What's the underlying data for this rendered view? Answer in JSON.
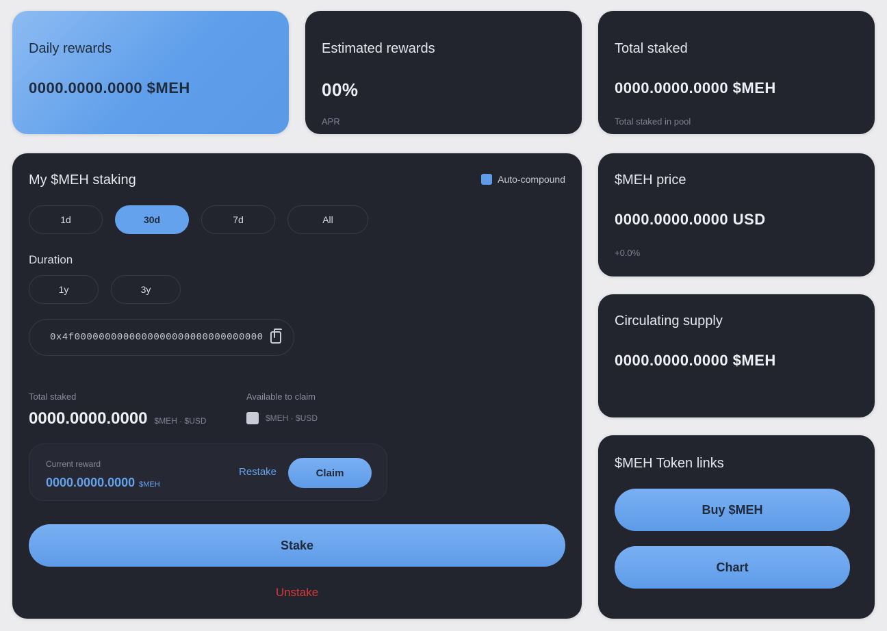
{
  "daily_rewards": {
    "title": "Daily rewards",
    "value": "0000.0000.0000 $MEH"
  },
  "estimated_rewards": {
    "title": "Estimated rewards",
    "value": "00%",
    "sub": "APR"
  },
  "total_staked": {
    "title": "Total staked",
    "value": "0000.0000.0000 $MEH",
    "sub": "Total staked in pool"
  },
  "staking": {
    "title": "My $MEH staking",
    "auto_compound_label": "Auto-compound",
    "periods": [
      "1d",
      "30d",
      "7d",
      "All"
    ],
    "active_period": "30d",
    "duration_label": "Duration",
    "durations": [
      "1y",
      "3y"
    ],
    "address_value": "0x4f0000000000000000000000000000000",
    "total_staked_label": "Total staked",
    "total_staked_value": "0000.0000.0000",
    "total_staked_unit": "$MEH · $USD",
    "available_label": "Available to claim",
    "available_value": "$MEH · $USD",
    "claim_label": "Current reward",
    "claim_value": "0000.0000.0000",
    "claim_unit": "$MEH",
    "restake_label": "Restake",
    "claim_button": "Claim",
    "stake_button": "Stake",
    "unstake_link": "Unstake"
  },
  "price": {
    "title": "$MEH price",
    "value": "0000.0000.0000 USD",
    "sub": "+0.0%"
  },
  "circulating": {
    "title": "Circulating supply",
    "value": "0000.0000.0000 $MEH"
  },
  "token_links": {
    "title": "$MEH Token links",
    "buy_button": "Buy $MEH",
    "chart_button": "Chart"
  },
  "colors": {
    "accent": "#64a2ee",
    "card": "#23252e",
    "danger": "#d23b3b",
    "background": "#ececee"
  }
}
